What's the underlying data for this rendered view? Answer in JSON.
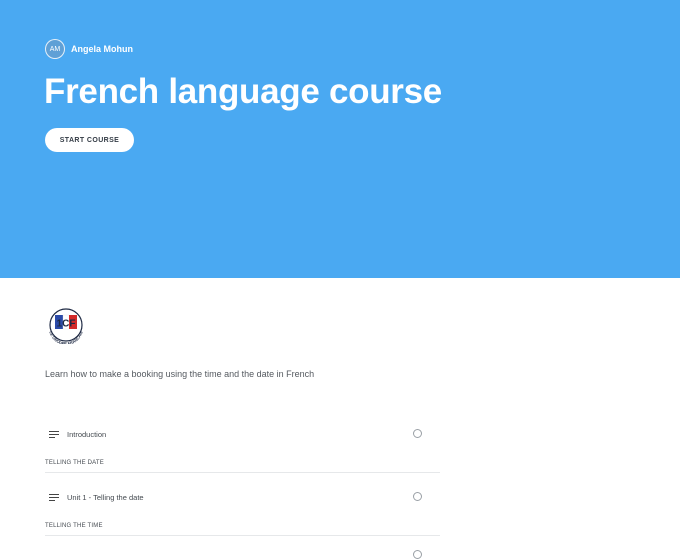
{
  "hero": {
    "author_initials": "AM",
    "author_name": "Angela Mohun",
    "title": "French language course",
    "start_button": "START COURSE",
    "background_color": "#4aa9f2"
  },
  "logo": {
    "top_text": "1CF",
    "bottom_text": "LE GROUPE FRANCAIS"
  },
  "description": "Learn how to make a booking using the time and the date in French",
  "curriculum": {
    "lesson_1": "Introduction",
    "section_1": "TELLING THE DATE",
    "lesson_2": "Unit 1 - Telling the date",
    "section_2": "TELLING THE TIME"
  }
}
